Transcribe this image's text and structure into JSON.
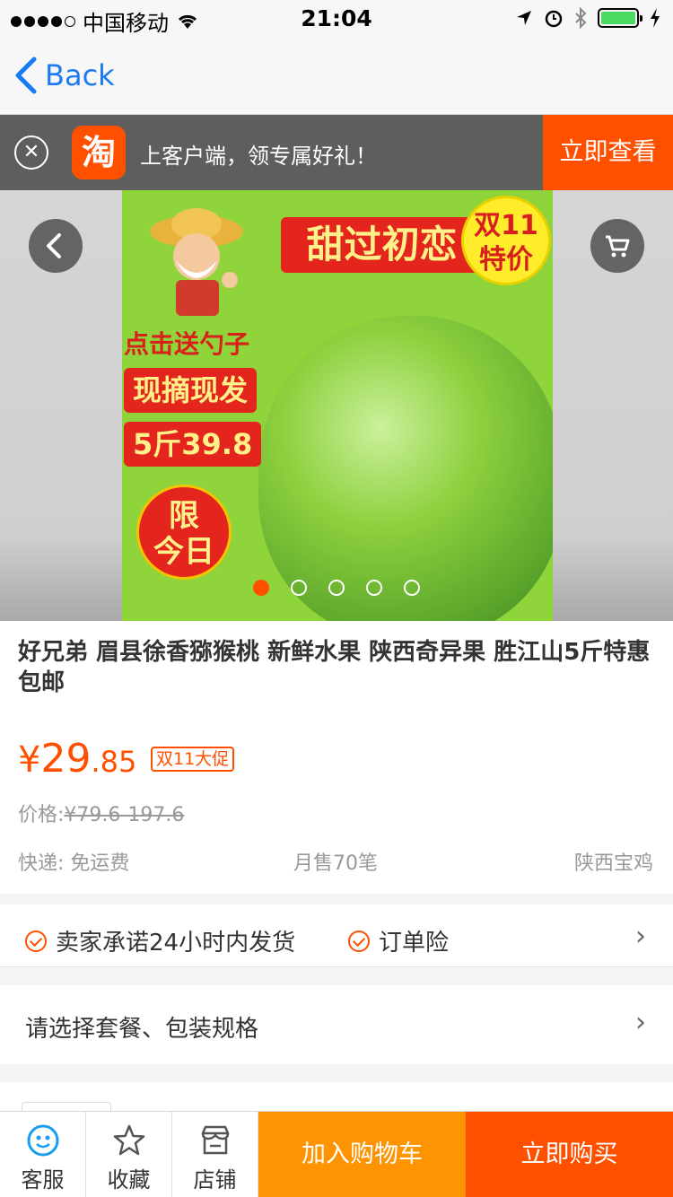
{
  "status_bar": {
    "carrier": "中国移动",
    "time": "21:04"
  },
  "nav": {
    "back_label": "Back"
  },
  "app_banner": {
    "logo_char": "淘",
    "text": "上客户端，领专属好礼！",
    "cta": "立即查看"
  },
  "gallery": {
    "image_text": {
      "slogan": "甜过初恋",
      "badge_line1": "双11",
      "badge_line2": "特价",
      "spoon": "点击送勺子",
      "fresh": "现摘现发",
      "deal": "5斤39.8",
      "today_line1": "限",
      "today_line2": "今日"
    },
    "slide_count": 5,
    "active_slide": 1
  },
  "product": {
    "title": "好兄弟 眉县徐香猕猴桃 新鲜水果 陕西奇异果 胜江山5斤特惠包邮",
    "price_symbol": "¥",
    "price_int": "29",
    "price_dec": ".85",
    "promo_tag": "双11大促",
    "orig_label": "价格:",
    "orig_price": "¥79.6-197.6",
    "shipping": "快递: 免运费",
    "monthly_sales": "月售70笔",
    "location": "陕西宝鸡"
  },
  "promises": {
    "item1": "卖家承诺24小时内发货",
    "item2": "订单险"
  },
  "spec": {
    "label": "请选择套餐、包装规格"
  },
  "bottom_bar": {
    "service": "客服",
    "favorite": "收藏",
    "shop": "店铺",
    "add_to_cart": "加入购物车",
    "buy_now": "立即购买"
  },
  "colors": {
    "accent": "#ff5000",
    "cart": "#ff9402",
    "ios_blue": "#1a7bf2"
  }
}
